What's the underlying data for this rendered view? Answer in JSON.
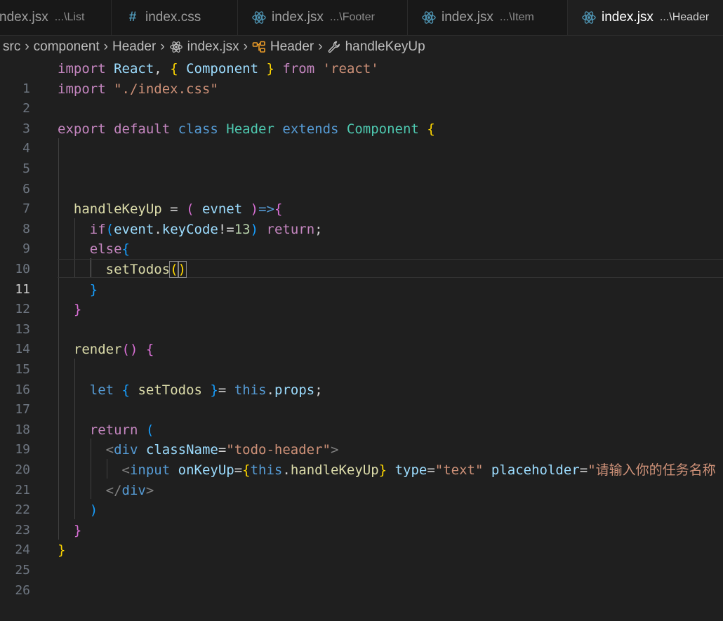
{
  "tabs": [
    {
      "label": "ndex.jsx",
      "path": "...\\List",
      "icon": "react-icon"
    },
    {
      "label": "index.css",
      "path": "",
      "icon": "css-hash-icon"
    },
    {
      "label": "index.jsx",
      "path": "...\\Footer",
      "icon": "react-icon"
    },
    {
      "label": "index.jsx",
      "path": "...\\Item",
      "icon": "react-icon"
    },
    {
      "label": "index.jsx",
      "path": "...\\Header",
      "icon": "react-icon",
      "active": true
    }
  ],
  "breadcrumb": {
    "items": [
      "src",
      "component",
      "Header",
      "index.jsx",
      "Header",
      "handleKeyUp"
    ]
  },
  "editor": {
    "current_line": 11,
    "line_numbers": [
      "1",
      "2",
      "3",
      "4",
      "5",
      "6",
      "7",
      "8",
      "9",
      "10",
      "11",
      "12",
      "13",
      "14",
      "15",
      "16",
      "17",
      "18",
      "19",
      "20",
      "21",
      "22",
      "23",
      "24",
      "25",
      "26"
    ],
    "tokens": {
      "import": "import",
      "react": "React",
      "comma": ", ",
      "lbrace": "{",
      "component": "Component",
      "rbrace": "}",
      "from": "from",
      "react_str": "'react'",
      "css_str": "\"./index.css\"",
      "export": "export",
      "default": "default",
      "class": "class",
      "header": "Header",
      "extends": "extends",
      "handleKeyUp": "handleKeyUp",
      "eq": " = ",
      "lparen": "(",
      "evnet": "evnet",
      "rparen": ")",
      "arrow": "=>",
      "if": "if",
      "event": "event",
      "dot": ".",
      "keyCode": "keyCode",
      "neq": "!=",
      "thirteen": "13",
      "return": "return",
      "semi": ";",
      "else": "else",
      "setTodos": "setTodos",
      "render": "render",
      "let": "let",
      "this": "this",
      "props": "props",
      "eqsign": "=",
      "lt": "<",
      "lt_slash": "</",
      "gt": ">",
      "div": "div",
      "className": "className",
      "todo_header": "\"todo-header\"",
      "input": "input",
      "onKeyUp": "onKeyUp",
      "type": "type",
      "text_str": "\"text\"",
      "placeholder": "placeholder",
      "placeholder_str": "\"请输入你的任务名称"
    }
  },
  "colors": {
    "background": "#1f1f1f",
    "keyword": "#c586c0",
    "storage": "#569cd6",
    "variable": "#9cdcfe",
    "type": "#4ec9b0",
    "function": "#dcdcaa",
    "string": "#ce9178",
    "number": "#b5cea8"
  }
}
